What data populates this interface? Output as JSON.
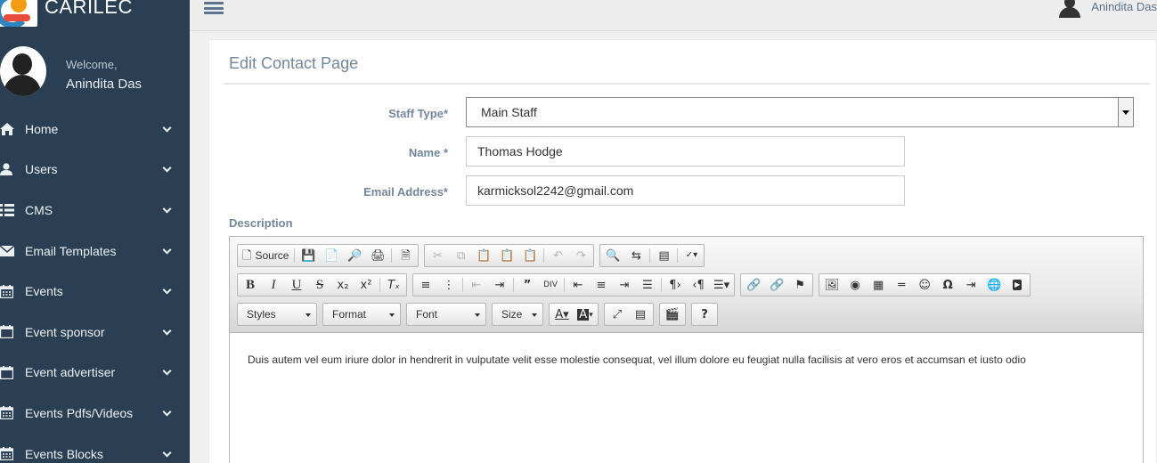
{
  "app": {
    "brand": "CARILEC"
  },
  "sidebar": {
    "welcome": "Welcome,",
    "username": "Anindita Das",
    "items": [
      {
        "label": "Home",
        "icon": "home-icon"
      },
      {
        "label": "Users",
        "icon": "user-icon"
      },
      {
        "label": "CMS",
        "icon": "list-icon"
      },
      {
        "label": "Email Templates",
        "icon": "envelope-icon"
      },
      {
        "label": "Events",
        "icon": "calendar-icon"
      },
      {
        "label": "Event sponsor",
        "icon": "calendar-icon"
      },
      {
        "label": "Event advertiser",
        "icon": "calendar-icon"
      },
      {
        "label": "Events Pdfs/Videos",
        "icon": "calendar-icon"
      },
      {
        "label": "Events Blocks",
        "icon": "calendar-icon"
      }
    ]
  },
  "topbar": {
    "user_name": "Anindita Das"
  },
  "page": {
    "title": "Edit Contact Page",
    "form": {
      "staff_type_label": "Staff Type*",
      "staff_type_value": "Main Staff",
      "name_label": "Name *",
      "name_value": "Thomas Hodge",
      "email_label": "Email Address*",
      "email_value": "karmicksol2242@gmail.com",
      "description_label": "Description"
    }
  },
  "editor": {
    "source_label": "Source",
    "combos": {
      "styles": "Styles",
      "format": "Format",
      "font": "Font",
      "size": "Size"
    },
    "content": "Duis autem vel eum iriure dolor in hendrerit in vulputate velit esse molestie consequat, vel illum dolore eu feugiat nulla facilisis at vero eros et accumsan et iusto odio"
  },
  "colors": {
    "sidebar_bg": "#2a3f54",
    "label_text": "#73879c",
    "topbar_bg": "#ededed"
  }
}
